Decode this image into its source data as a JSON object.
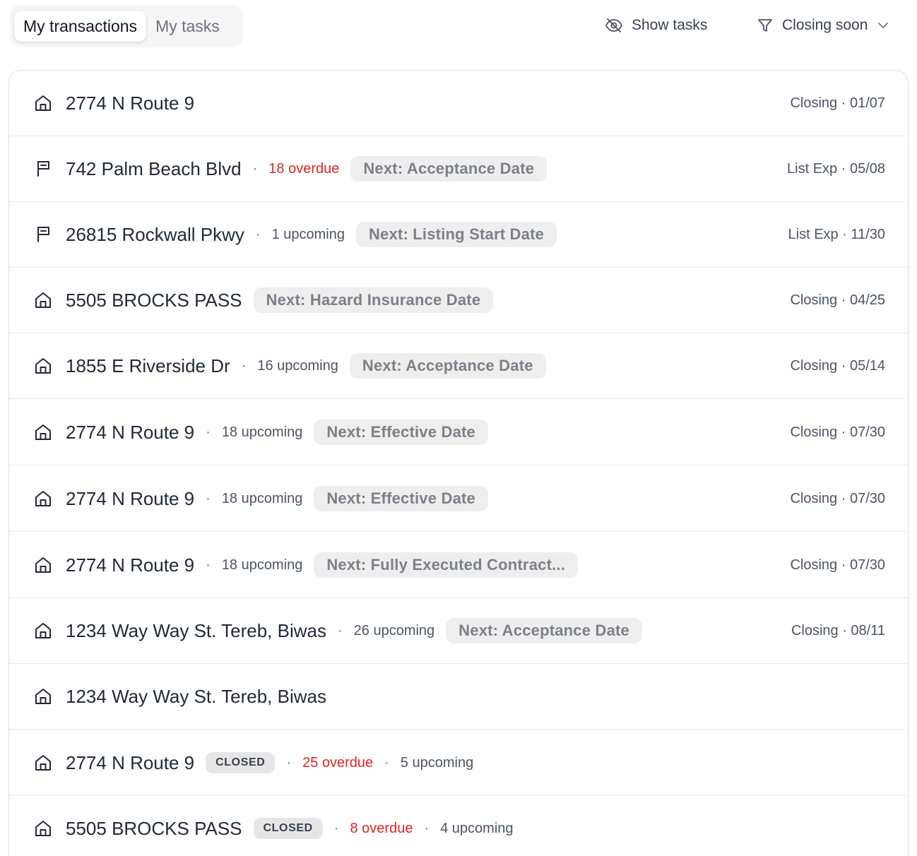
{
  "tabs": [
    {
      "label": "My transactions",
      "active": true
    },
    {
      "label": "My tasks",
      "active": false
    }
  ],
  "actions": {
    "show_tasks": {
      "label": "Show tasks",
      "icon": "eye-off-icon"
    },
    "filter": {
      "label": "Closing soon",
      "icon": "filter-icon"
    }
  },
  "rows": [
    {
      "icon": "house-icon",
      "address": "2774 N Route 9",
      "status": "",
      "overdue": "",
      "upcoming": "",
      "next": "",
      "right": "Closing · 01/07"
    },
    {
      "icon": "sign-icon",
      "address": "742 Palm Beach Blvd",
      "status": "",
      "overdue": "18 overdue",
      "upcoming": "",
      "next": "Next: Acceptance Date",
      "right": "List Exp · 05/08"
    },
    {
      "icon": "sign-icon",
      "address": "26815 Rockwall Pkwy",
      "status": "",
      "overdue": "",
      "upcoming": "1 upcoming",
      "next": "Next: Listing Start Date",
      "right": "List Exp · 11/30"
    },
    {
      "icon": "house-icon",
      "address": "5505 BROCKS PASS",
      "status": "",
      "overdue": "",
      "upcoming": "",
      "next": "Next: Hazard Insurance Date",
      "right": "Closing · 04/25"
    },
    {
      "icon": "house-icon",
      "address": "1855 E Riverside Dr",
      "status": "",
      "overdue": "",
      "upcoming": "16 upcoming",
      "next": "Next: Acceptance Date",
      "right": "Closing · 05/14"
    },
    {
      "icon": "house-icon",
      "address": "2774 N Route 9",
      "status": "",
      "overdue": "",
      "upcoming": "18 upcoming",
      "next": "Next: Effective Date",
      "right": "Closing · 07/30"
    },
    {
      "icon": "house-icon",
      "address": "2774 N Route 9",
      "status": "",
      "overdue": "",
      "upcoming": "18 upcoming",
      "next": "Next: Effective Date",
      "right": "Closing · 07/30"
    },
    {
      "icon": "house-icon",
      "address": "2774 N Route 9",
      "status": "",
      "overdue": "",
      "upcoming": "18 upcoming",
      "next": "Next: Fully Executed Contract...",
      "right": "Closing · 07/30"
    },
    {
      "icon": "house-icon",
      "address": "1234 Way Way St. Tereb, Biwas",
      "status": "",
      "overdue": "",
      "upcoming": "26 upcoming",
      "next": "Next: Acceptance Date",
      "right": "Closing · 08/11"
    },
    {
      "icon": "house-icon",
      "address": "1234 Way Way St. Tereb, Biwas",
      "status": "",
      "overdue": "",
      "upcoming": "",
      "next": "",
      "right": ""
    },
    {
      "icon": "house-icon",
      "address": "2774 N Route 9",
      "status": "CLOSED",
      "overdue": "25 overdue",
      "upcoming": "5 upcoming",
      "next": "",
      "right": ""
    },
    {
      "icon": "house-icon",
      "address": "5505 BROCKS PASS",
      "status": "CLOSED",
      "overdue": "8 overdue",
      "upcoming": "4 upcoming",
      "next": "",
      "right": ""
    }
  ],
  "colors": {
    "overdue": "#dc2626",
    "chip_bg": "#eeeeee",
    "text": "#1f2937"
  }
}
